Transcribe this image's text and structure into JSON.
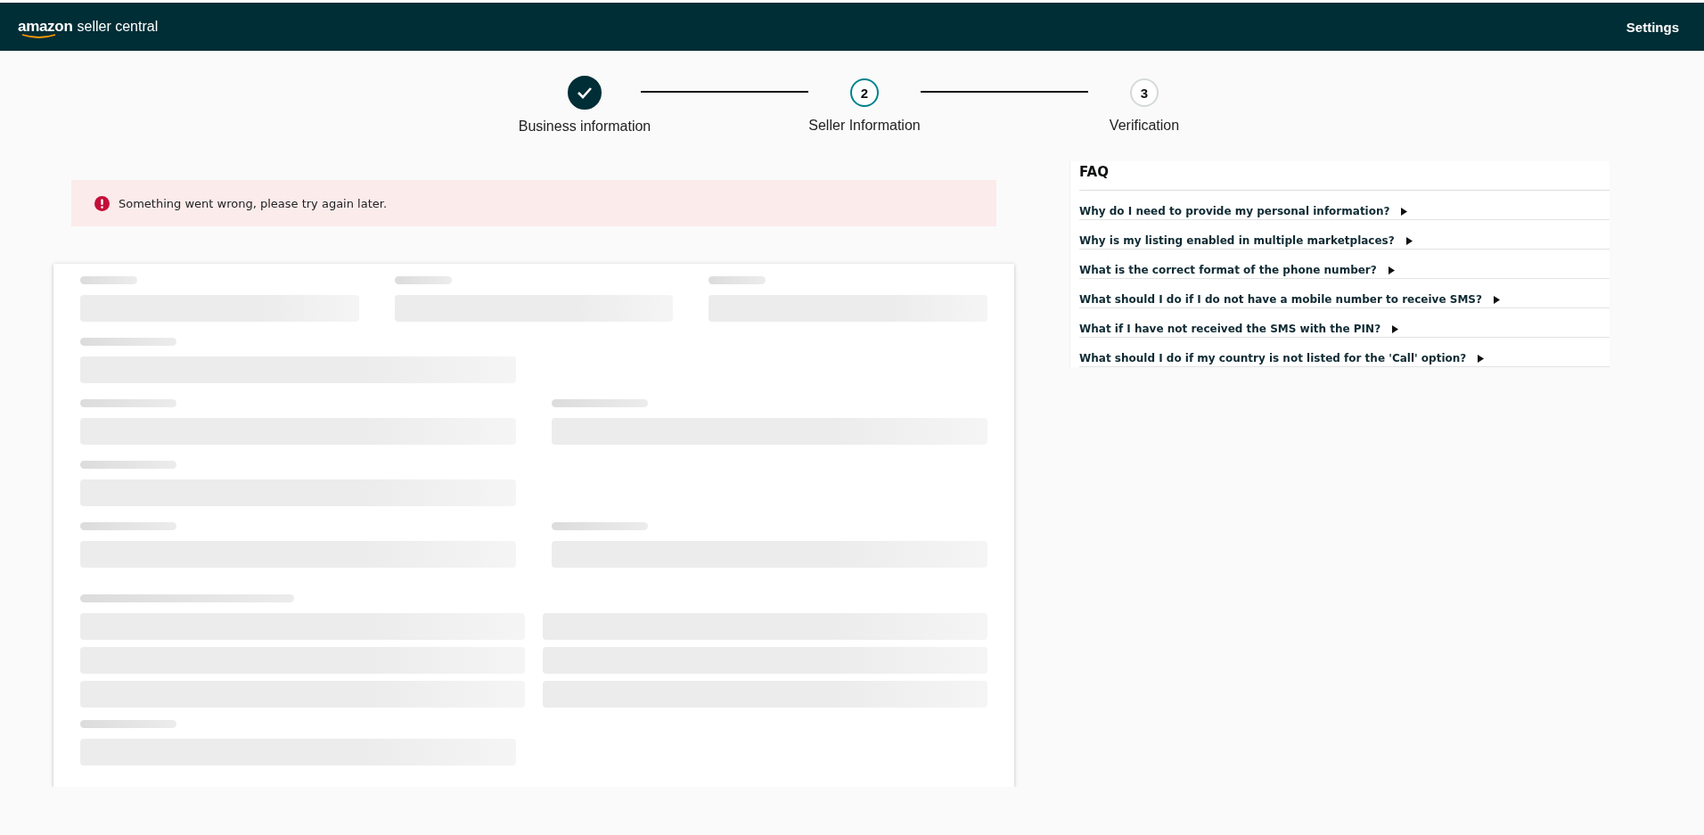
{
  "header": {
    "logo_brand": "amazon",
    "logo_product": "seller central",
    "settings": "Settings"
  },
  "steps": [
    {
      "label": "Business information",
      "completed": true,
      "selected": false
    },
    {
      "number": "2",
      "label": "Seller Information",
      "completed": false,
      "selected": true
    },
    {
      "number": "3",
      "label": "Verification",
      "completed": false,
      "selected": false
    }
  ],
  "alert": {
    "message": "Something went wrong, please try again later."
  },
  "faq": {
    "title": "FAQ",
    "items": [
      {
        "question": "Why do I need to provide my personal information?",
        "expanded": false
      },
      {
        "question": "Why is my listing enabled in multiple marketplaces?",
        "expanded": false
      },
      {
        "question": "What is the correct format of the phone number?",
        "expanded": false
      },
      {
        "question": "What should I do if I do not have a mobile number to receive SMS?",
        "expanded": false
      },
      {
        "question": "What if I have not received the SMS with the PIN?",
        "expanded": false
      },
      {
        "question": "What should I do if my country is not listed for the 'Call' option?",
        "expanded": false
      }
    ]
  }
}
